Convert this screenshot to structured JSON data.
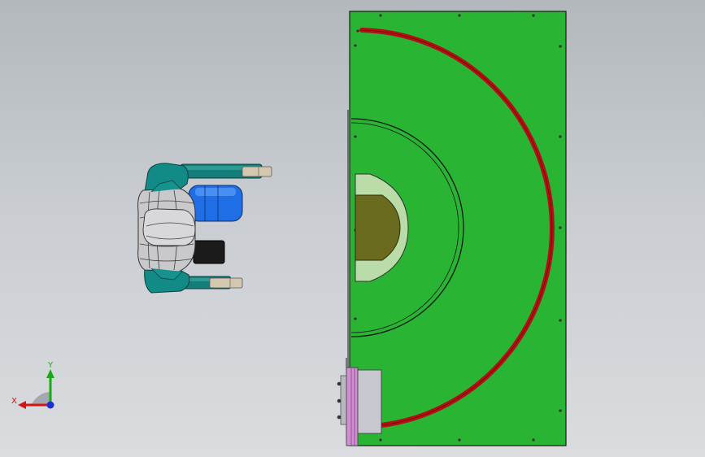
{
  "viewport": {
    "background_top": "#b3b8bd",
    "background_bottom": "#dadcdf"
  },
  "colors": {
    "plate": "#29b533",
    "plate_edge": "#1a1a1a",
    "rail": "#b30f14",
    "holder_fill": "#6b6b1f",
    "holder_shell": "#b9dca9",
    "robot_teal": "#138c88",
    "robot_grey": "#c8c8c8",
    "robot_blue": "#1f6ee6",
    "robot_black": "#1b1b1b",
    "panel_grey": "#c7c7cf",
    "panel_magenta": "#d28ed2"
  },
  "triad": {
    "x_label": "X",
    "y_label": "Y",
    "x_color": "#d21414",
    "y_color": "#18a818",
    "z_color": "#1e2fd2"
  }
}
